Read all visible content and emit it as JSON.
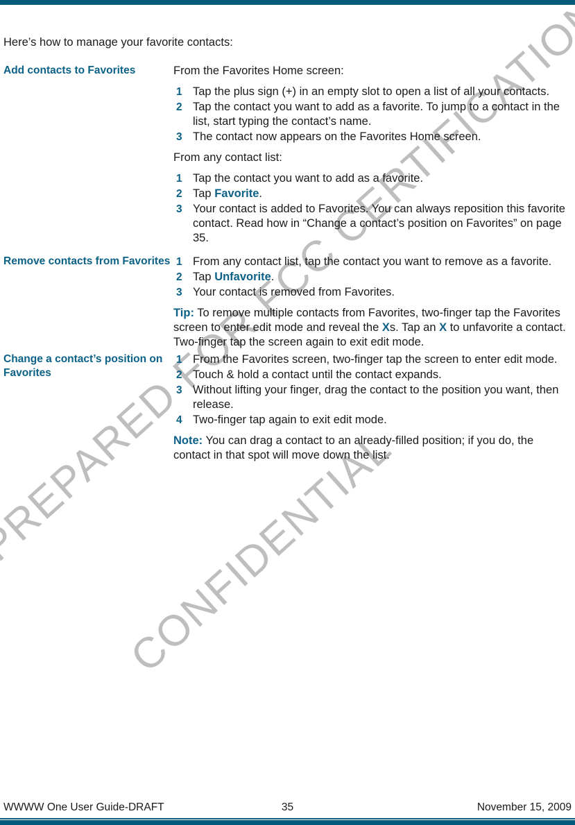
{
  "theme": {
    "rule_color": "#005a78",
    "heading_color": "#0c6187",
    "body_color": "#1a1a1a",
    "watermark_color": "#b9b9b9"
  },
  "watermark": {
    "line1": "PREPARED FOR FCC CERTIFICATION",
    "line2": "CONFIDENTIAL"
  },
  "intro": "Here’s how to manage your favorite contacts:",
  "sections": [
    {
      "heading": "Add contacts to Favorites",
      "lead1": "From the Favorites Home screen:",
      "steps1": [
        {
          "num": "1",
          "text": "Tap the plus sign (+) in an empty slot to open a list of all your contacts."
        },
        {
          "num": "2",
          "text": "Tap the contact you want to add as a favorite. To jump to a contact in the list, start typing the contact’s name."
        },
        {
          "num": "3",
          "text": "The contact now appears on the Favorites Home screen."
        }
      ],
      "lead2": "From any contact list:",
      "steps2": [
        {
          "num": "1",
          "text": "Tap the contact you want to add as a favorite."
        },
        {
          "num": "2",
          "pre": "Tap ",
          "term": "Favorite",
          "post": "."
        },
        {
          "num": "3",
          "text": "Your contact is added to Favorites. You can always reposition this favorite contact. Read how in “Change a contact’s position on Favorites” on page 35."
        }
      ]
    },
    {
      "heading": "Remove contacts from Favorites",
      "steps1": [
        {
          "num": "1",
          "text": "From any contact list, tap the contact you want to remove as a favorite."
        },
        {
          "num": "2",
          "pre": "Tap ",
          "term": "Unfavorite",
          "post": "."
        },
        {
          "num": "3",
          "text": "Your contact is removed from Favorites."
        }
      ],
      "note_label": "Tip:",
      "note_part1": " To remove multiple contacts from Favorites, two-finger tap the Favorites screen to enter edit mode and reveal the ",
      "note_x1": "X",
      "note_part2": "s. Tap an ",
      "note_x2": "X",
      "note_part3": " to unfavorite a contact. Two-finger tap the screen again to exit edit mode."
    },
    {
      "heading": "Change a contact’s position on Favorites",
      "steps1": [
        {
          "num": "1",
          "text": "From the Favorites screen, two-finger tap the screen to enter edit mode."
        },
        {
          "num": "2",
          "text": "Touch & hold a contact until the contact expands."
        },
        {
          "num": "3",
          "text": "Without lifting your finger, drag the contact to the position you want, then release."
        },
        {
          "num": "4",
          "text": "Two-finger tap again to exit edit mode."
        }
      ],
      "note_label": "Note:",
      "note_text": " You can drag a contact to an already-filled position; if you do, the contact in that spot will move down the list."
    }
  ],
  "footer": {
    "left": "WWWW One User Guide-DRAFT",
    "page_number": "35",
    "right": "November 15, 2009"
  }
}
